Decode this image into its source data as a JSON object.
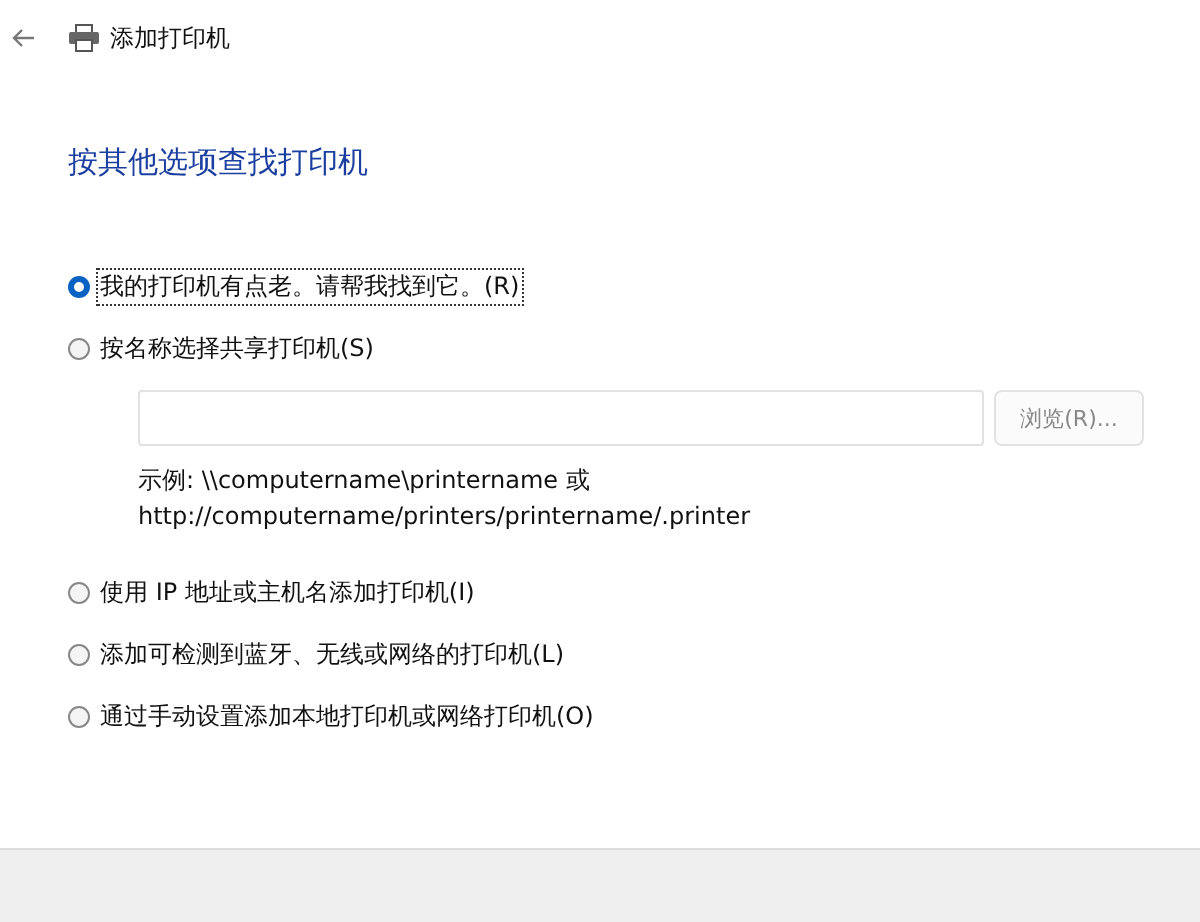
{
  "window": {
    "title": "添加打印机"
  },
  "heading": "按其他选项查找打印机",
  "options": [
    {
      "label": "我的打印机有点老。请帮我找到它。(R)",
      "selected": true
    },
    {
      "label": "按名称选择共享打印机(S)",
      "selected": false,
      "kind": "share"
    },
    {
      "label": "使用 IP 地址或主机名添加打印机(I)",
      "selected": false
    },
    {
      "label": "添加可检测到蓝牙、无线或网络的打印机(L)",
      "selected": false
    },
    {
      "label": "通过手动设置添加本地打印机或网络打印机(O)",
      "selected": false
    }
  ],
  "share": {
    "browse_button": {
      "label": "浏览(R)...",
      "disabled": true
    },
    "example_lines": [
      "示例: \\\\computername\\printername 或",
      "http://computername/printers/printername/.printer"
    ]
  }
}
